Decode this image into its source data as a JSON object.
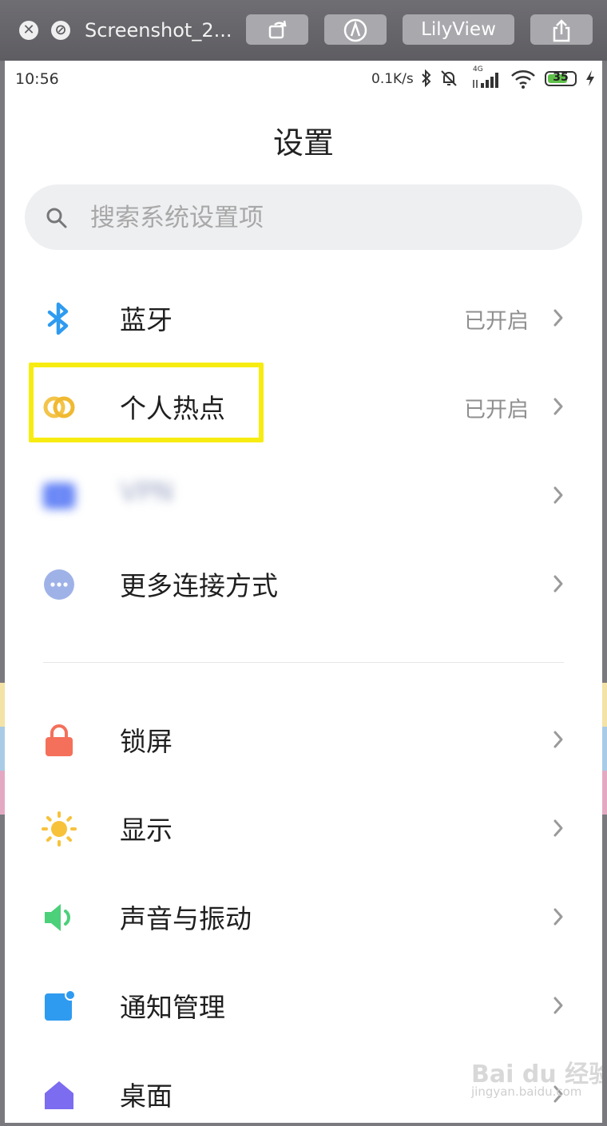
{
  "window": {
    "title": "Screenshot_2...",
    "lilyview_label": "LilyView"
  },
  "status_bar": {
    "time": "10:56",
    "net_speed": "0.1K/s",
    "network_type": "4G",
    "battery": "35",
    "battery_color": "#5fc04a"
  },
  "page": {
    "title": "设置"
  },
  "search": {
    "placeholder": "搜索系统设置项"
  },
  "rows": [
    {
      "label": "蓝牙",
      "status": "已开启",
      "icon": "bluetooth-icon",
      "color": "#2f9bf0"
    },
    {
      "label": "个人热点",
      "status": "已开启",
      "icon": "hotspot-icon",
      "color": "#f3c44a"
    },
    {
      "label": "VPN",
      "status": "",
      "icon": "vpn-icon",
      "color": "#5b7cf5"
    },
    {
      "label": "更多连接方式",
      "status": "",
      "icon": "more-connections-icon",
      "color": "#9fb2e8"
    },
    {
      "label": "锁屏",
      "status": "",
      "icon": "lock-icon",
      "color": "#f4705a"
    },
    {
      "label": "显示",
      "status": "",
      "icon": "sun-icon",
      "color": "#f7c23a"
    },
    {
      "label": "声音与振动",
      "status": "",
      "icon": "speaker-icon",
      "color": "#4cd07a"
    },
    {
      "label": "通知管理",
      "status": "",
      "icon": "notification-icon",
      "color": "#2f9bf0"
    },
    {
      "label": "桌面",
      "status": "",
      "icon": "home-icon",
      "color": "#7c6cf0"
    }
  ],
  "watermark": {
    "text": "Bai du 经验",
    "sub": "jingyan.baidu.com"
  }
}
